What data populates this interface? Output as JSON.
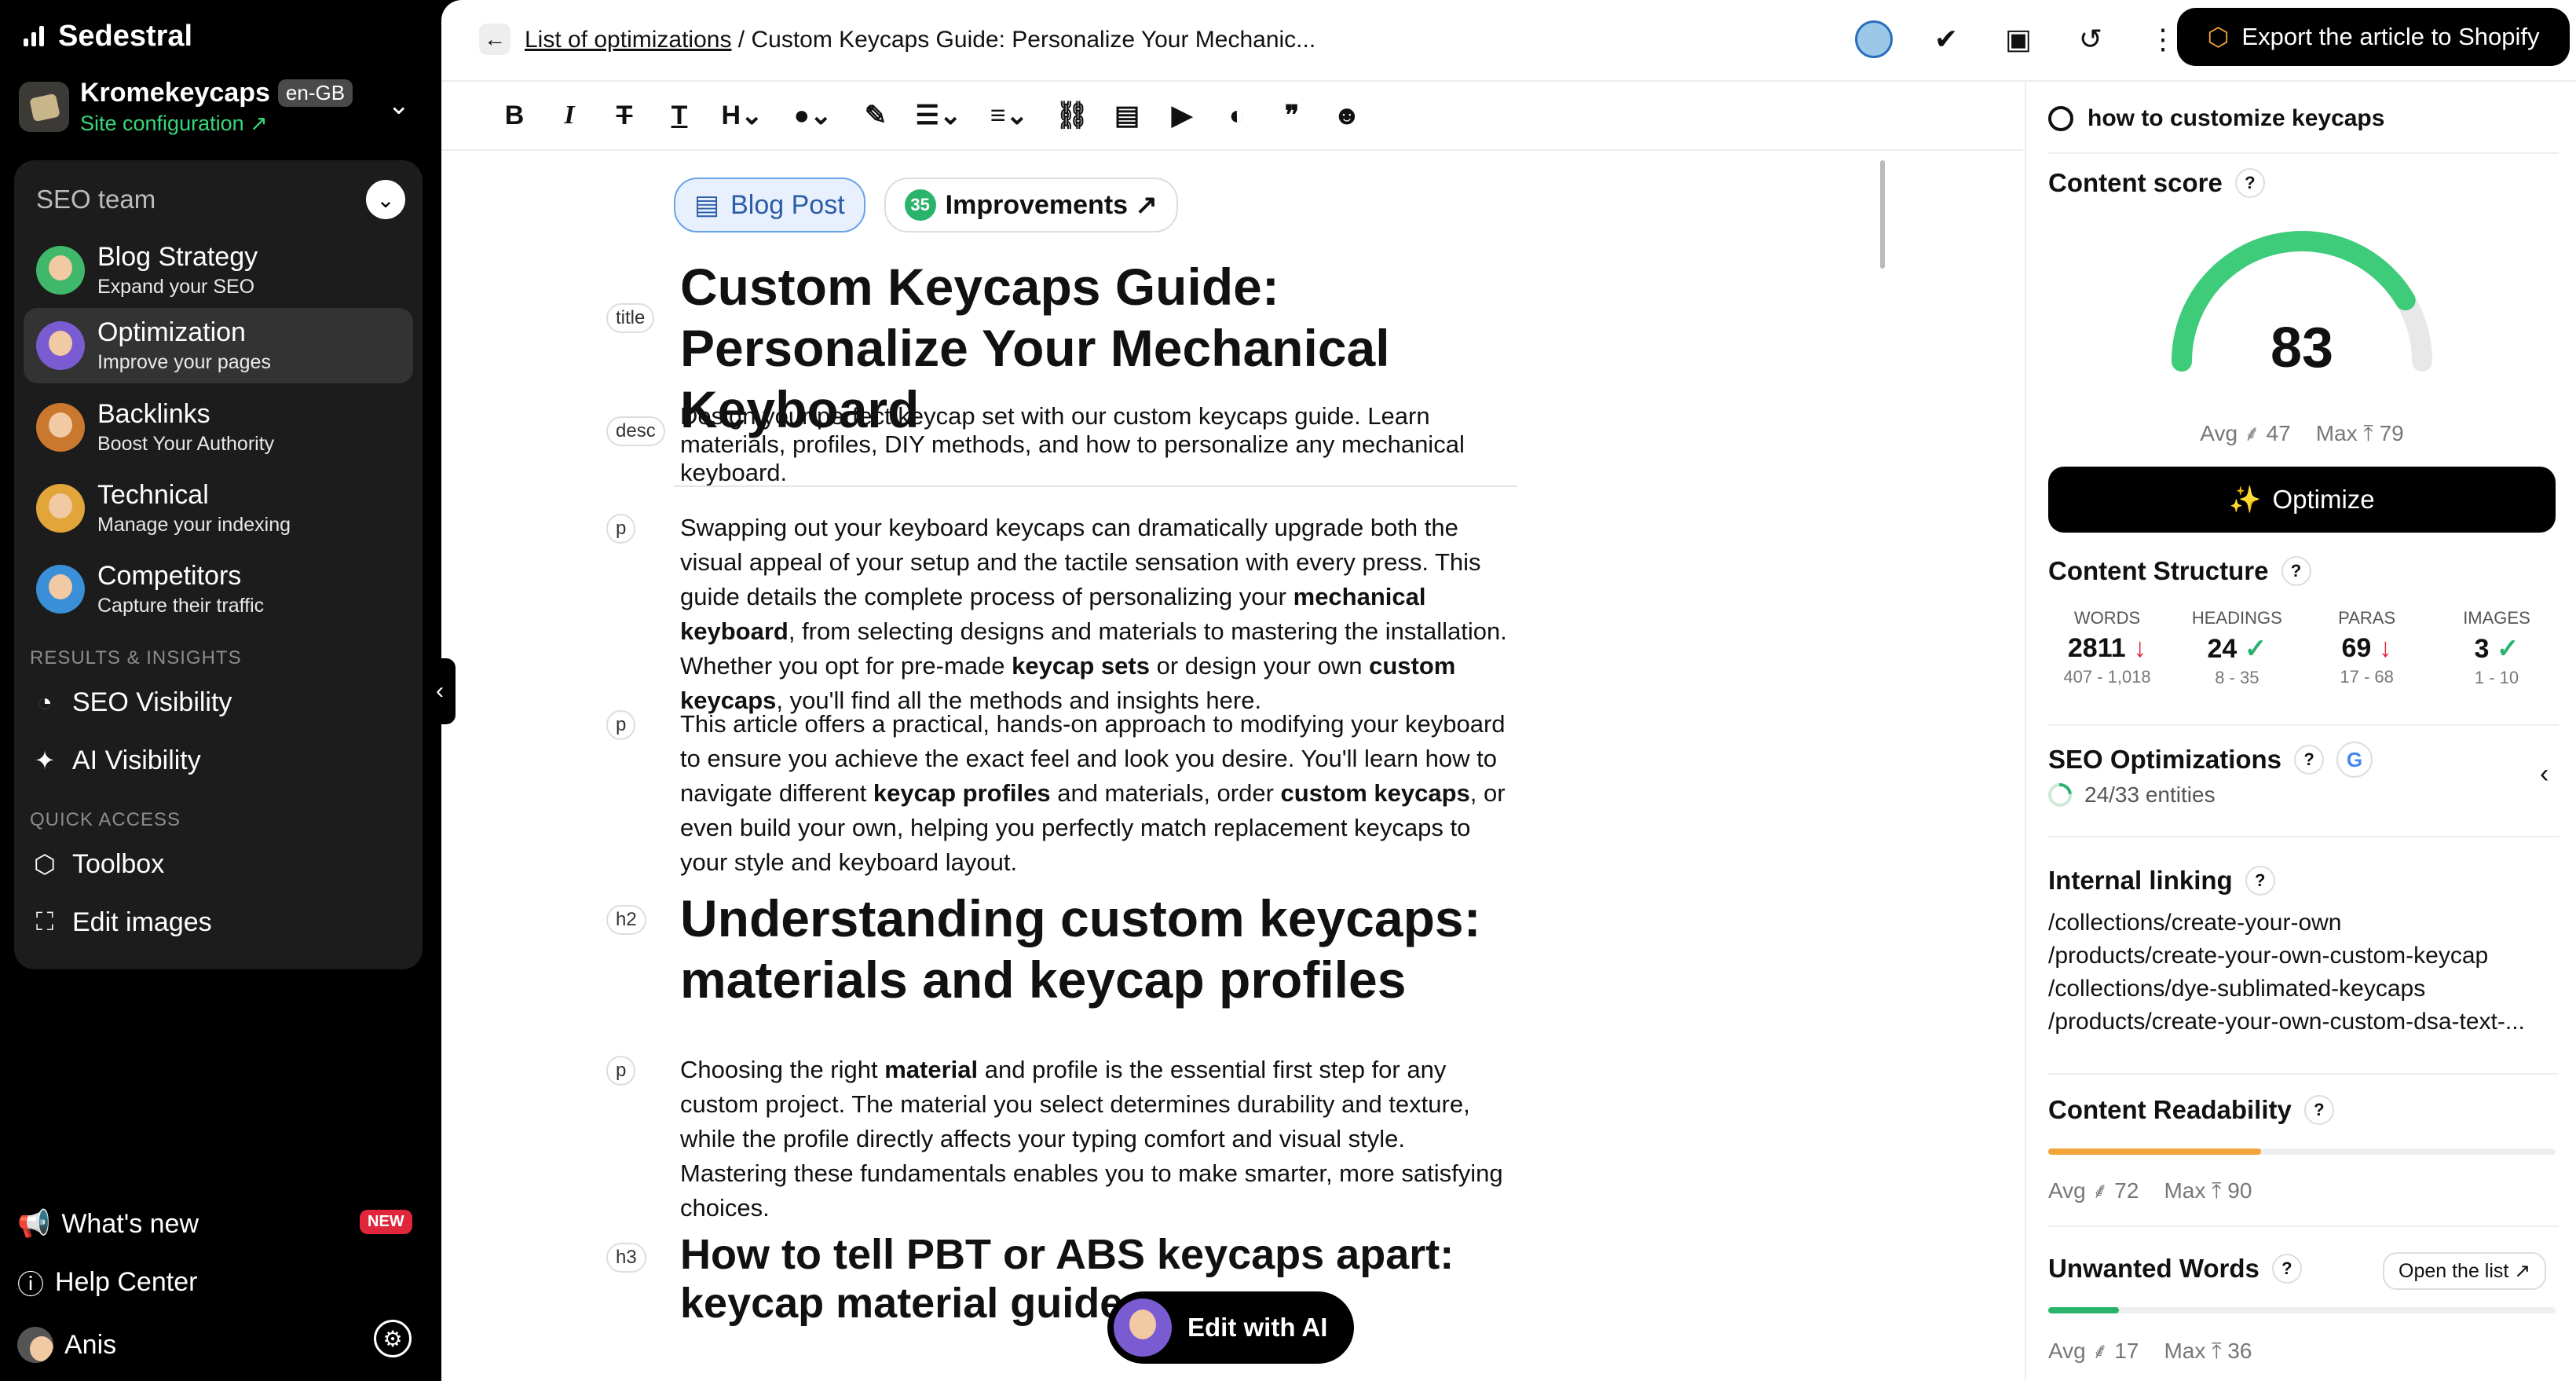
{
  "app": {
    "name": "Sedestral"
  },
  "site": {
    "name": "Kromekeycaps",
    "lang": "en-GB",
    "config_label": "Site configuration ↗"
  },
  "team": {
    "label": "SEO team"
  },
  "agents": [
    {
      "title": "Blog Strategy",
      "subtitle": "Expand your SEO",
      "color": "#3fb86b"
    },
    {
      "title": "Optimization",
      "subtitle": "Improve your pages",
      "color": "#7a5bd1",
      "active": true
    },
    {
      "title": "Backlinks",
      "subtitle": "Boost Your Authority",
      "color": "#c9782e"
    },
    {
      "title": "Technical",
      "subtitle": "Manage your indexing",
      "color": "#e2a53a"
    },
    {
      "title": "Competitors",
      "subtitle": "Capture their traffic",
      "color": "#3a8fd6"
    }
  ],
  "sections": {
    "results": "RESULTS & INSIGHTS",
    "quick": "QUICK ACCESS"
  },
  "nav": {
    "seo_visibility": "SEO Visibility",
    "ai_visibility": "AI Visibility",
    "toolbox": "Toolbox",
    "edit_images": "Edit images"
  },
  "bottom": {
    "whats_new": "What's new",
    "new_badge": "NEW",
    "help": "Help Center",
    "user": "Anis"
  },
  "breadcrumb": {
    "link": "List of optimizations",
    "sep": " / ",
    "current": "Custom Keycaps Guide: Personalize Your Mechanic..."
  },
  "export_label": "Export the article to Shopify",
  "tags": {
    "type": "Blog Post",
    "improvements_count": "35",
    "improvements_label": "Improvements ↗"
  },
  "article": {
    "title": "Custom Keycaps Guide: Personalize Your Mechanical Keyboard",
    "desc": "Design your perfect keycap set with our custom keycaps guide. Learn materials, profiles, DIY methods, and how to personalize any mechanical keyboard.",
    "p1": [
      "Swapping out your keyboard keycaps can dramatically upgrade both the visual appeal of your setup and the tactile sensation with every press. This guide details the complete process of personalizing your ",
      {
        "b": "mechanical keyboard"
      },
      ", from selecting designs and materials to mastering the installation. Whether you opt for pre-made ",
      {
        "b": "keycap sets"
      },
      " or design your own ",
      {
        "b": "custom keycaps"
      },
      ", you'll find all the methods and insights here."
    ],
    "p2": [
      "This article offers a practical, hands-on approach to modifying your keyboard to ensure you achieve the exact feel and look you desire. You'll learn how to navigate different ",
      {
        "b": "keycap profiles"
      },
      " and materials, order ",
      {
        "b": "custom keycaps"
      },
      ", or even build your own, helping you perfectly match replacement keycaps to your style and keyboard layout."
    ],
    "h2": "Understanding custom keycaps: materials and keycap profiles",
    "p3": [
      "Choosing the right ",
      {
        "b": "material"
      },
      " and profile is the essential first step for any custom project. The material you select determines durability and texture, while the profile directly affects your typing comfort and visual style. Mastering these fundamentals enables you to make smarter, more satisfying choices."
    ],
    "h3": "How to tell PBT or ABS keycaps apart: keycap material guide"
  },
  "labels": {
    "title": "title",
    "desc": "desc",
    "p": "p",
    "h2": "h2",
    "h3": "h3"
  },
  "edit_ai": "Edit with AI",
  "panel": {
    "keyword": "how to customize keycaps",
    "content_score": {
      "label": "Content score",
      "value": 83,
      "max_scale": 100,
      "avg": "Avg ⸙ 47",
      "max": "Max ⤒ 79"
    },
    "optimize": "Optimize",
    "structure": {
      "label": "Content Structure",
      "items": [
        {
          "k": "WORDS",
          "v": "2811",
          "trend": "down",
          "r": "407 - 1,018"
        },
        {
          "k": "HEADINGS",
          "v": "24",
          "trend": "ok",
          "r": "8 - 35"
        },
        {
          "k": "PARAS",
          "v": "69",
          "trend": "down",
          "r": "17 - 68"
        },
        {
          "k": "IMAGES",
          "v": "3",
          "trend": "ok",
          "r": "1 - 10"
        }
      ]
    },
    "seo_opt": {
      "label": "SEO Optimizations",
      "entities": "24/33 entities"
    },
    "internal": {
      "label": "Internal linking",
      "links": [
        "/collections/create-your-own",
        "/products/create-your-own-custom-keycap",
        "/collections/dye-sublimated-keycaps",
        "/products/create-your-own-custom-dsa-text-..."
      ]
    },
    "readability": {
      "label": "Content Readability",
      "fill": 0.42,
      "color": "#f2a43a",
      "avg": "Avg ⸙ 72",
      "max": "Max ⤒ 90"
    },
    "unwanted": {
      "label": "Unwanted Words",
      "open": "Open the list ↗",
      "fill": 0.14,
      "color": "#2ab36b",
      "avg": "Avg ⸙ 17",
      "max": "Max ⤒ 36"
    }
  }
}
